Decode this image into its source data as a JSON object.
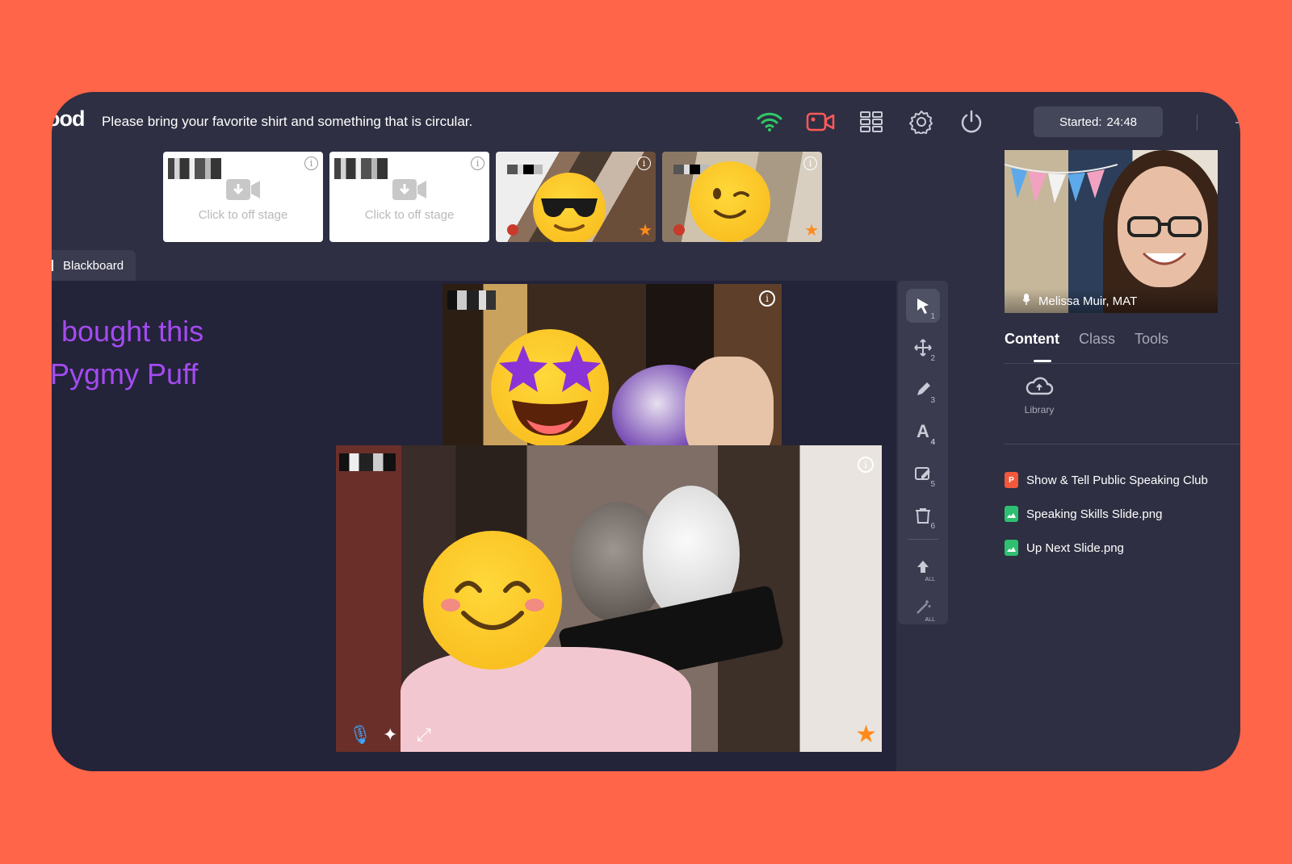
{
  "app": {
    "logo_text": "ood",
    "notice": "Please bring your favorite shirt and something that is circular.",
    "started_label": "Started:",
    "started_time": "24:48",
    "icons": [
      "wifi-icon",
      "camera-icon",
      "layout-grid-icon",
      "settings-icon",
      "power-icon"
    ],
    "colors": {
      "background": "#FF6548",
      "panel": "#2E2F42",
      "board": "#23233A",
      "accent_text": "#A44BF0",
      "wifi": "#2EC866",
      "camera": "#FF5A5A"
    }
  },
  "thumbnails": [
    {
      "type": "off-stage",
      "label": "Click to off stage"
    },
    {
      "type": "off-stage",
      "label": "Click to off stage"
    },
    {
      "type": "camera",
      "emoji": "sunglasses-emoji-icon",
      "stars": "7"
    },
    {
      "type": "camera",
      "emoji": "wink-emoji-icon",
      "stars": "7"
    }
  ],
  "blackboard": {
    "tab_label": "Blackboard",
    "lines": [
      "bought this",
      "Pygmy Puff"
    ]
  },
  "stage": {
    "video1": {
      "emoji": "star-eyes-emoji-icon",
      "stars": "6"
    },
    "video2": {
      "emoji": "smile-emoji-icon",
      "stars": "7"
    }
  },
  "toolbar": {
    "tools": [
      {
        "name": "select",
        "num": "1"
      },
      {
        "name": "move",
        "num": "2"
      },
      {
        "name": "pen",
        "num": "3"
      },
      {
        "name": "text",
        "num": "4",
        "glyph": "A"
      },
      {
        "name": "eraser",
        "num": "5"
      },
      {
        "name": "clear",
        "num": "6"
      },
      {
        "name": "upload-all",
        "num": "ALL"
      },
      {
        "name": "magic-all",
        "num": "ALL"
      }
    ]
  },
  "teacher": {
    "name": "Melissa Muir, MAT"
  },
  "panel": {
    "tabs": [
      "Content",
      "Class",
      "Tools"
    ],
    "active_tab": "Content",
    "library_label": "Library",
    "files": [
      {
        "name": "Show & Tell Public Speaking Club",
        "type": "P",
        "color": "#F2593A"
      },
      {
        "name": "Speaking Skills Slide.png",
        "type": "",
        "color": "#2FBF71"
      },
      {
        "name": "Up Next Slide.png",
        "type": "",
        "color": "#2FBF71"
      }
    ]
  }
}
